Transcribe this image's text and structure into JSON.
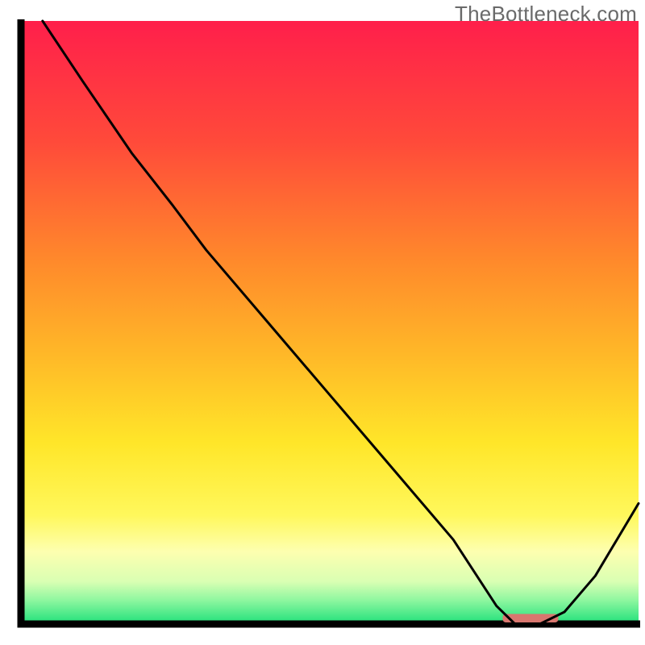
{
  "watermark": "TheBottleneck.com",
  "chart_data": {
    "type": "line",
    "title": "",
    "xlabel": "",
    "ylabel": "",
    "xlim": [
      0,
      100
    ],
    "ylim": [
      0,
      100
    ],
    "axes": {
      "left": true,
      "bottom": true,
      "right": false,
      "top": false,
      "ticks": "none",
      "grid": false
    },
    "background_gradient": {
      "orientation": "vertical",
      "stops": [
        {
          "offset": 0.0,
          "color": "#ff1f4b"
        },
        {
          "offset": 0.2,
          "color": "#ff4a3a"
        },
        {
          "offset": 0.4,
          "color": "#ff8a2b"
        },
        {
          "offset": 0.55,
          "color": "#ffb728"
        },
        {
          "offset": 0.7,
          "color": "#ffe629"
        },
        {
          "offset": 0.82,
          "color": "#fff85c"
        },
        {
          "offset": 0.88,
          "color": "#fdffb0"
        },
        {
          "offset": 0.93,
          "color": "#d9ffb3"
        },
        {
          "offset": 0.96,
          "color": "#8ff7a0"
        },
        {
          "offset": 1.0,
          "color": "#1fe07a"
        }
      ]
    },
    "series": [
      {
        "name": "curve",
        "color": "#000000",
        "stroke_width": 3,
        "x": [
          3.5,
          10,
          18,
          24.5,
          30,
          40,
          50,
          60,
          70,
          77,
          80,
          84,
          88,
          93,
          100
        ],
        "y": [
          100,
          90,
          78,
          69.5,
          62,
          50,
          38,
          26,
          14,
          3,
          0,
          0,
          2,
          8,
          20
        ]
      }
    ],
    "marker_bar": {
      "x_start": 78,
      "x_end": 87,
      "y": 0,
      "height_pct": 1.4,
      "color": "#d9776f",
      "radius": 4
    }
  }
}
